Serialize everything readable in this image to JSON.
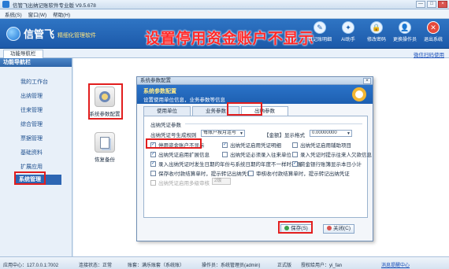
{
  "window": {
    "title": "信管飞出纳记账软件专业版 V9.5.678",
    "controls": [
      "—",
      "□",
      "×"
    ]
  },
  "menu": [
    "系统(S)",
    "窗口(W)",
    "帮助(H)"
  ],
  "banner": {
    "brand": "信管飞",
    "slogan": "精细化管理软件",
    "headline": "设置停用资金账户不显示",
    "tools": [
      {
        "label": "日记账明细",
        "icon": "ledger-icon",
        "glyph": "✎"
      },
      {
        "label": "AI助手",
        "icon": "ai-icon",
        "glyph": "✦"
      },
      {
        "label": "修改密码",
        "icon": "lock-icon",
        "glyph": "🔒"
      },
      {
        "label": "更换操作员",
        "icon": "user-icon",
        "glyph": "👤"
      },
      {
        "label": "退出系统",
        "icon": "exit-icon",
        "glyph": "✕"
      }
    ]
  },
  "tabstrip": {
    "home_tab": "功能导航栏",
    "link": "微信扫码使用"
  },
  "sidebar": {
    "header": "功能导航栏",
    "items": [
      "我的工作台",
      "出纳管理",
      "往来管理",
      "综合管理",
      "票据管理",
      "基础资料",
      "扩展应用",
      "系统管理"
    ],
    "active_index": 7
  },
  "modules": [
    {
      "label": "系统参数配置"
    },
    {
      "label": "恢复备份"
    }
  ],
  "dialog": {
    "title": "系统参数配置",
    "close": "×",
    "banner_title": "系统参数配置",
    "banner_subtitle": "设置使用单位信息，业务参数等信息",
    "tabs": [
      "使用单位",
      "业务参数",
      "出纳参数"
    ],
    "active_tab": 2,
    "section": "出纳凭证参数",
    "rule_label": "出纳凭证号生成规则",
    "rule_value": "每账户按月连号",
    "amount_label": "【金额】显示格式",
    "amount_value": "0.00000000",
    "options": [
      {
        "label": "停用资金账户不显示",
        "checked": true,
        "disabled": false
      },
      {
        "label": "出纳凭证启用凭证明细",
        "checked": true,
        "disabled": false
      },
      {
        "label": "出纳凭证启用辅助项目",
        "checked": false,
        "disabled": false
      },
      {
        "label": "出纳凭证启用扩展信息",
        "checked": true,
        "disabled": false
      },
      {
        "label": "出纳凭证必须录入往来单位",
        "checked": false,
        "disabled": false
      },
      {
        "label": "录入凭证时提示往来人欠款信息",
        "checked": false,
        "disabled": false
      },
      {
        "label": "录入出纳凭证时发生日期的年份与系统日期的年度不一样时提醒",
        "checked": true,
        "disabled": false
      },
      {
        "label": "资金银行账簿显示本日小计",
        "checked": true,
        "disabled": false
      },
      {
        "label": "保存收/付款结算单时，提示转记出纳凭证",
        "checked": false,
        "disabled": false
      },
      {
        "label": "审核收/付款结算单时，提示转记出纳凭证",
        "checked": false,
        "disabled": false
      },
      {
        "label": "出纳凭证启用多级审核",
        "checked": false,
        "disabled": true
      }
    ],
    "level_value": "2级",
    "save_button": "保存(S)",
    "close_button": "关闭(C)"
  },
  "status": {
    "app_center": "应用中心：127.0.0.1:7002",
    "sync": "连接状态：正常",
    "account": "账套：满乐账套（系统账）",
    "operator": "操作员：系统管理员(admin)",
    "edition": "正式版",
    "license": "授权给用户：yi_fan",
    "link": "消息提醒中心"
  }
}
